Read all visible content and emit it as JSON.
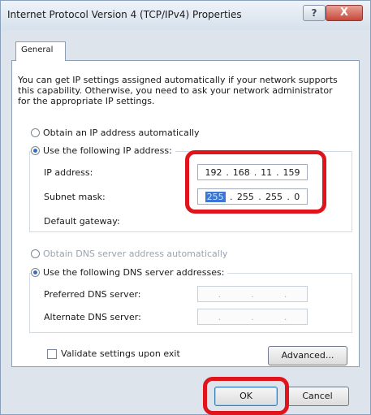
{
  "window": {
    "title": "Internet Protocol Version 4 (TCP/IPv4) Properties",
    "help_glyph": "?",
    "close_glyph": "X"
  },
  "tab": {
    "label": "General"
  },
  "intro_text": "You can get IP settings assigned automatically if your network supports this capability. Otherwise, you need to ask your network administrator for the appropriate IP settings.",
  "ip_section": {
    "obtain_auto_label": "Obtain an IP address automatically",
    "use_following_label": "Use the following IP address:",
    "ip_address_label": "IP address:",
    "ip_address_value": [
      "192",
      "168",
      "11",
      "159"
    ],
    "subnet_label": "Subnet mask:",
    "subnet_value": [
      "255",
      "255",
      "255",
      "0"
    ],
    "gateway_label": "Default gateway:"
  },
  "dns_section": {
    "obtain_auto_label": "Obtain DNS server address automatically",
    "use_following_label": "Use the following DNS server addresses:",
    "preferred_label": "Preferred DNS server:",
    "alternate_label": "Alternate DNS server:"
  },
  "validate_label": "Validate settings upon exit",
  "buttons": {
    "advanced": "Advanced...",
    "ok": "OK",
    "cancel": "Cancel"
  },
  "ip_dot": ".",
  "colors": {
    "highlight_box": "#e0141c",
    "selection": "#3a77d6"
  }
}
